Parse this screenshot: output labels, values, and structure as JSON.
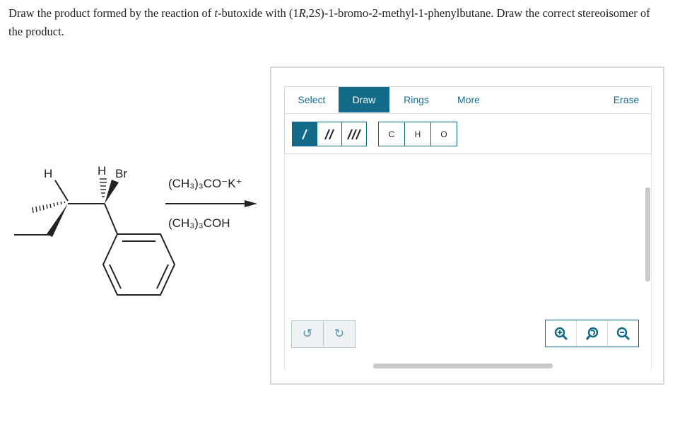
{
  "question": {
    "part1": "Draw the product formed by the reaction of ",
    "t": "t",
    "part2": "-butoxide with (1",
    "r": "R",
    "part3": ",2",
    "s": "S",
    "part4": ")-1-bromo-2-methyl-1-phenylbutane. Draw the correct stereoisomer of the product."
  },
  "scheme": {
    "h_left": "H",
    "h_top": "H",
    "br": "Br",
    "reagent_above": "(CH₃)₃CO⁻K⁺",
    "reagent_below": "(CH₃)₃COH"
  },
  "tabs": [
    {
      "label": "Select"
    },
    {
      "label": "Draw"
    },
    {
      "label": "Rings"
    },
    {
      "label": "More"
    },
    {
      "label": "Erase"
    }
  ],
  "bond_tools": [
    {
      "glyph": "/",
      "icon": "single-bond-icon"
    },
    {
      "glyph": "//",
      "icon": "double-bond-icon"
    },
    {
      "glyph": "///",
      "icon": "triple-bond-icon"
    }
  ],
  "atom_tools": [
    {
      "label": "C"
    },
    {
      "label": "H"
    },
    {
      "label": "O"
    }
  ],
  "undo": {
    "icon": "undo-icon",
    "glyph": "↺"
  },
  "redo": {
    "icon": "redo-icon",
    "glyph": "↻"
  },
  "zoom": [
    "zoom-in-icon",
    "zoom-reset-icon",
    "zoom-out-icon"
  ],
  "colors": {
    "accent": "#136b8a",
    "tab_text": "#1a6f8f"
  }
}
